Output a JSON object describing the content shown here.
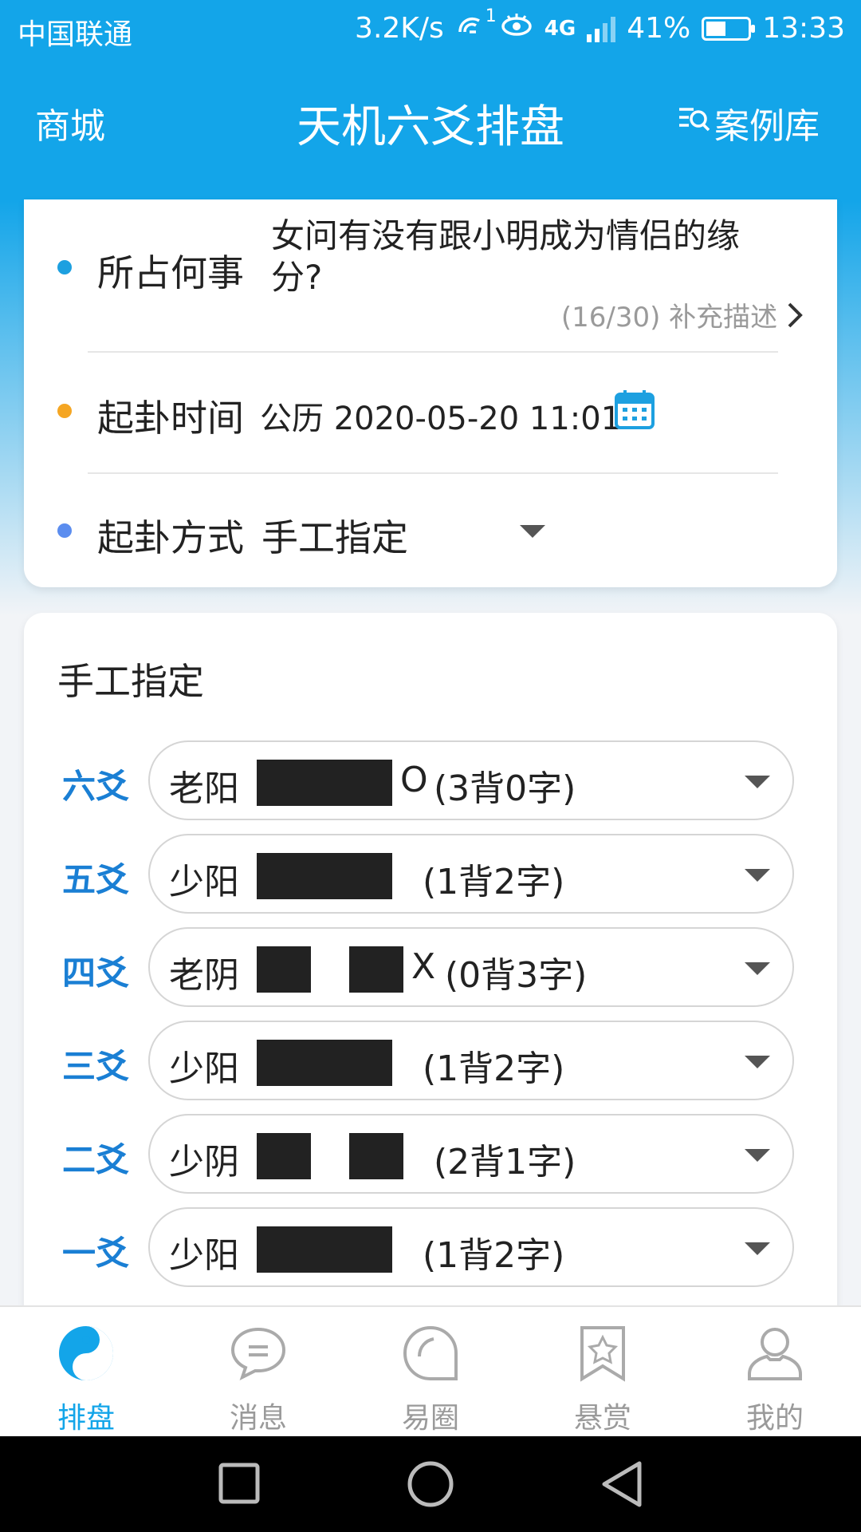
{
  "status_bar": {
    "carrier": "中国联通",
    "speed": "3.2K/s",
    "hotspot_count": "1",
    "network": "4G",
    "battery": "41%",
    "time": "13:33"
  },
  "nav": {
    "left": "商城",
    "title": "天机六爻排盘",
    "right": "案例库"
  },
  "question_card": {
    "subject_label": "所占何事",
    "question": "女问有没有跟小明成为情侣的缘分?",
    "counter": "(16/30) 补充描述",
    "time_label": "起卦时间",
    "time_value": "公历 2020-05-20 11:01",
    "method_label": "起卦方式",
    "method_value": "手工指定",
    "colors": {
      "subject_dot": "#1da0e0",
      "time_dot": "#f5a623",
      "method_dot": "#5b8def"
    }
  },
  "manual": {
    "title": "手工指定",
    "yao": [
      {
        "label": "六爻",
        "name": "老阳",
        "type": "yang",
        "mark": "O",
        "count": "(3背0字)"
      },
      {
        "label": "五爻",
        "name": "少阳",
        "type": "yang",
        "mark": "",
        "count": "(1背2字)"
      },
      {
        "label": "四爻",
        "name": "老阴",
        "type": "yin",
        "mark": "X",
        "count": "(0背3字)"
      },
      {
        "label": "三爻",
        "name": "少阳",
        "type": "yang",
        "mark": "",
        "count": "(1背2字)"
      },
      {
        "label": "二爻",
        "name": "少阴",
        "type": "yin",
        "mark": "",
        "count": "(2背1字)"
      },
      {
        "label": "一爻",
        "name": "少阳",
        "type": "yang",
        "mark": "",
        "count": "(1背2字)"
      }
    ]
  },
  "tabs": [
    {
      "label": "排盘",
      "icon": "yinyang-icon",
      "active": true
    },
    {
      "label": "消息",
      "icon": "chat-bubble-icon",
      "active": false
    },
    {
      "label": "易圈",
      "icon": "circle-bubble-icon",
      "active": false
    },
    {
      "label": "悬赏",
      "icon": "star-bookmark-icon",
      "active": false
    },
    {
      "label": "我的",
      "icon": "person-icon",
      "active": false
    }
  ]
}
